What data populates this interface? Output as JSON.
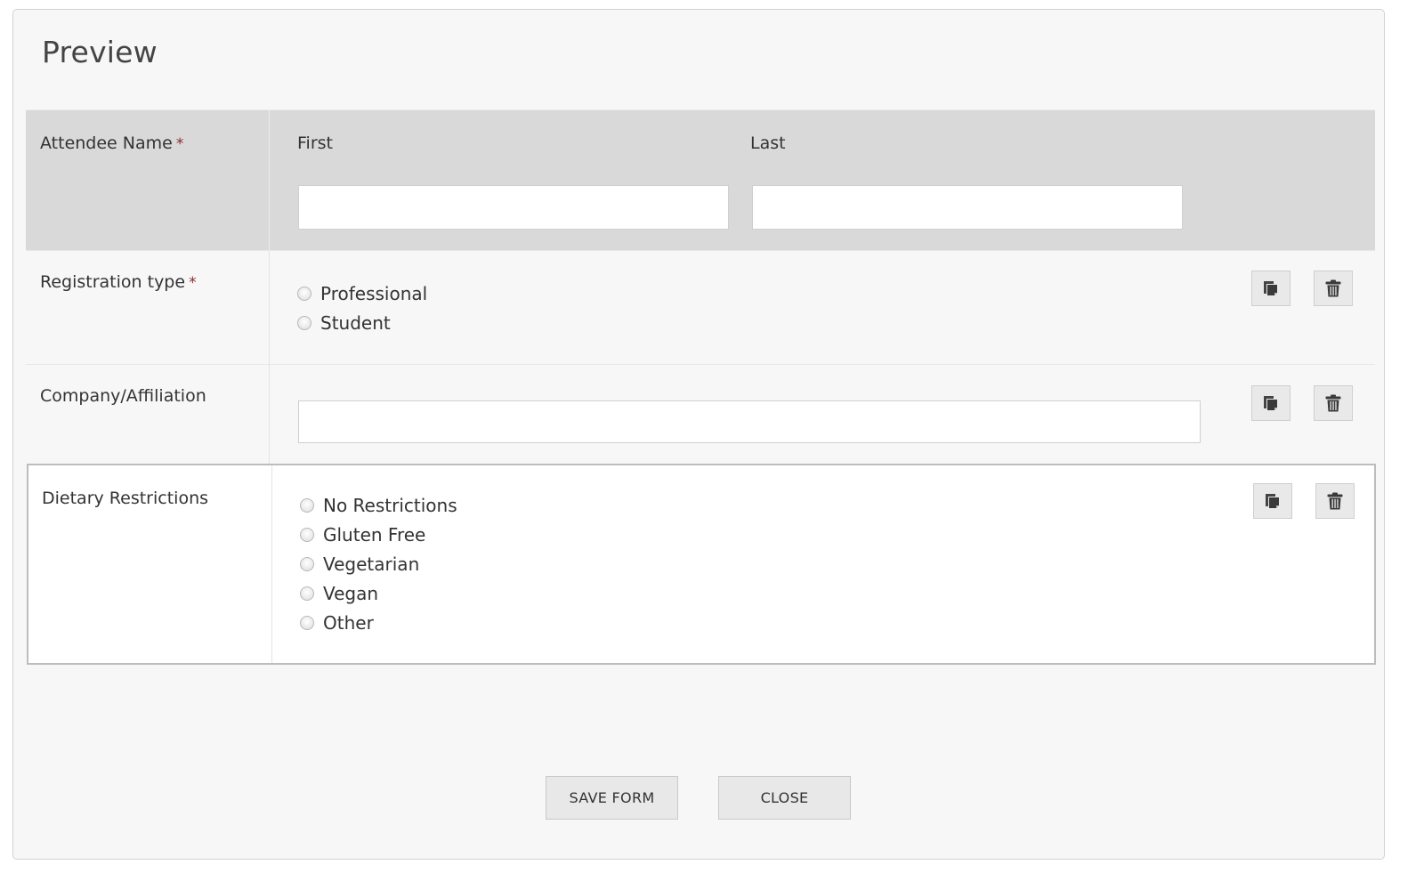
{
  "dialog": {
    "title": "Preview"
  },
  "fields": {
    "attendee_name": {
      "label": "Attendee Name",
      "required_marker": "*",
      "first_label": "First",
      "last_label": "Last",
      "first_value": "",
      "last_value": ""
    },
    "registration_type": {
      "label": "Registration type",
      "required_marker": "*",
      "options": [
        "Professional",
        "Student"
      ]
    },
    "company": {
      "label": "Company/Affiliation",
      "value": ""
    },
    "dietary": {
      "label": "Dietary Restrictions",
      "options": [
        "No Restrictions",
        "Gluten Free",
        "Vegetarian",
        "Vegan",
        "Other"
      ]
    }
  },
  "row_actions": {
    "copy_icon": "copy-icon",
    "delete_icon": "trash-icon"
  },
  "footer": {
    "save_label": "SAVE FORM",
    "close_label": "CLOSE"
  },
  "colors": {
    "required": "#8b2a2a",
    "selected_row_border": "#bdbdbd",
    "header_row_bg": "#d9d9d9"
  }
}
